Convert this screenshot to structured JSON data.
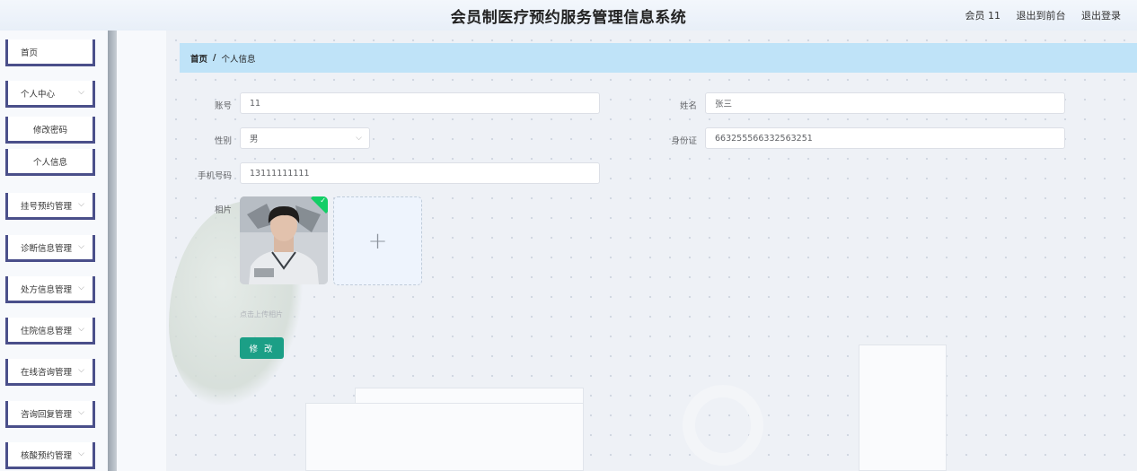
{
  "header": {
    "title": "会员制医疗预约服务管理信息系统",
    "user_label": "会员 11",
    "front_link": "退出到前台",
    "logout_link": "退出登录"
  },
  "sidebar": {
    "items": [
      {
        "label": "首页"
      },
      {
        "label": "个人中心"
      },
      {
        "label": "修改密码"
      },
      {
        "label": "个人信息"
      },
      {
        "label": "挂号预约管理"
      },
      {
        "label": "诊断信息管理"
      },
      {
        "label": "处方信息管理"
      },
      {
        "label": "住院信息管理"
      },
      {
        "label": "在线咨询管理"
      },
      {
        "label": "咨询回复管理"
      },
      {
        "label": "核酸预约管理"
      }
    ]
  },
  "breadcrumb": {
    "home": "首页",
    "separator": "/",
    "current": "个人信息"
  },
  "form": {
    "account_label": "账号",
    "account_value": "11",
    "name_label": "姓名",
    "name_value": "张三",
    "gender_label": "性别",
    "gender_value": "男",
    "idcard_label": "身份证",
    "idcard_value": "663255566332563251",
    "phone_label": "手机号码",
    "phone_value": "13111111111",
    "photo_label": "相片",
    "upload_tip": "点击上传相片",
    "submit_label": "修 改"
  },
  "colors": {
    "accent": "#1b9f86",
    "breadcrumb_bg": "#bfe3f8",
    "sidebar_border": "#4a4f8a"
  }
}
